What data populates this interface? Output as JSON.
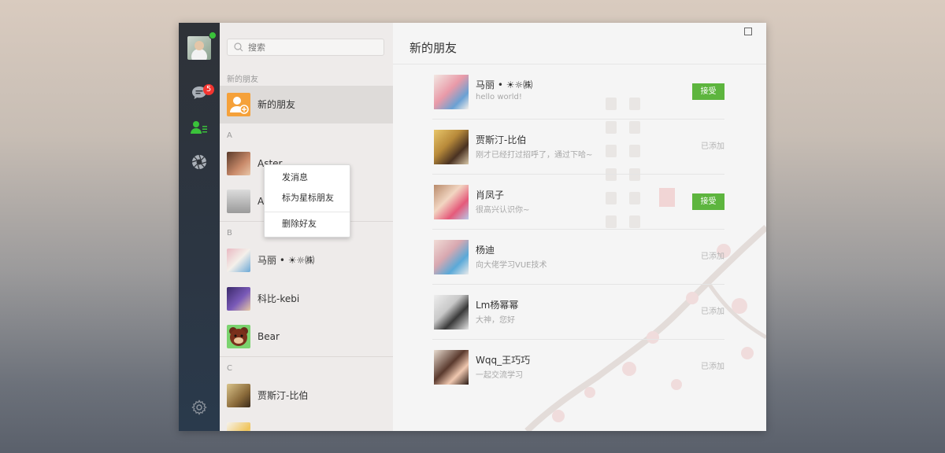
{
  "colors": {
    "accent_green": "#5db53e",
    "badge_red": "#f43530",
    "nav_bg": "#2e3238"
  },
  "nav": {
    "unread_badge": "5",
    "icons": [
      "chat-icon",
      "contacts-icon",
      "moments-icon",
      "settings-icon"
    ]
  },
  "search": {
    "placeholder": "搜索"
  },
  "contacts": {
    "section_new": "新的朋友",
    "new_friends_label": "新的朋友",
    "group_a": "A",
    "group_b": "B",
    "group_c": "C",
    "items": [
      {
        "name": "Aster"
      },
      {
        "name": "A"
      },
      {
        "name": "马丽 • ☀☼㈱"
      },
      {
        "name": "科比-kebi"
      },
      {
        "name": "Bear"
      },
      {
        "name": "贾斯汀-比伯"
      }
    ]
  },
  "context_menu": {
    "send_message": "发消息",
    "star_friend": "标为星标朋友",
    "delete_friend": "删除好友"
  },
  "main": {
    "title": "新的朋友",
    "requests": [
      {
        "name": "马丽 • ☀☼㈱",
        "message": "hello world!",
        "status": "接受"
      },
      {
        "name": "贾斯汀-比伯",
        "message": "刚才已经打过招呼了，通过下哈~",
        "status": "已添加"
      },
      {
        "name": "肖凤子",
        "message": "很高兴认识你~",
        "status": "接受"
      },
      {
        "name": "杨迪",
        "message": "向大佬学习VUE技术",
        "status": "已添加"
      },
      {
        "name": "Lm杨幂幂",
        "message": "大神，您好",
        "status": "已添加"
      },
      {
        "name": "Wqq_王巧巧",
        "message": "一起交流学习",
        "status": "已添加"
      }
    ]
  }
}
